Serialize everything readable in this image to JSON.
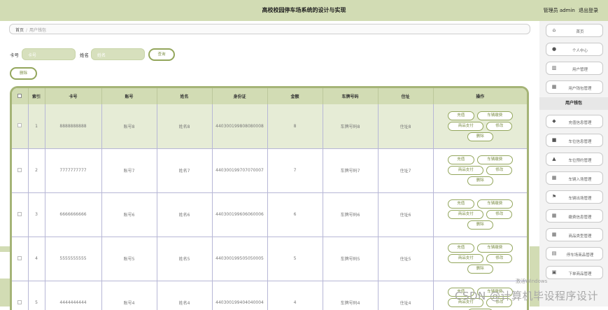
{
  "header": {
    "title": "高校校园停车场系统的设计与实现",
    "user_role": "管理员 admin",
    "logout": "退出登录"
  },
  "breadcrumb": {
    "home": "首页",
    "current": "用户钱包"
  },
  "search": {
    "card_label": "卡号",
    "card_placeholder": "卡号",
    "name_label": "姓名",
    "name_placeholder": "姓名",
    "query_button": "查询"
  },
  "delete_button": "删除",
  "table": {
    "headers": [
      "",
      "索引",
      "卡号",
      "账号",
      "姓名",
      "身份证",
      "金额",
      "车牌号码",
      "住址",
      "操作"
    ],
    "rows": [
      {
        "index": "1",
        "card": "8888888888",
        "account": "账号8",
        "name": "姓名8",
        "id_card": "440300199808080008",
        "amount": "8",
        "plate": "车牌号码8",
        "address": "住址8"
      },
      {
        "index": "2",
        "card": "7777777777",
        "account": "账号7",
        "name": "姓名7",
        "id_card": "440300199707070007",
        "amount": "7",
        "plate": "车牌号码7",
        "address": "住址7"
      },
      {
        "index": "3",
        "card": "6666666666",
        "account": "账号6",
        "name": "姓名6",
        "id_card": "440300199606060006",
        "amount": "6",
        "plate": "车牌号码6",
        "address": "住址6"
      },
      {
        "index": "4",
        "card": "5555555555",
        "account": "账号5",
        "name": "姓名5",
        "id_card": "440300199505050005",
        "amount": "5",
        "plate": "车牌号码5",
        "address": "住址5"
      },
      {
        "index": "5",
        "card": "4444444444",
        "account": "账号4",
        "name": "姓名4",
        "id_card": "440300199404040004",
        "amount": "4",
        "plate": "车牌号码4",
        "address": "住址4"
      }
    ],
    "ops": {
      "recharge": "充值",
      "car_fee": "车辆缴费",
      "goods_pay": "商品支付",
      "edit": "修改",
      "delete": "删除"
    }
  },
  "sidebar": {
    "items": [
      {
        "label": "首页",
        "icon": "home-icon"
      },
      {
        "label": "个人中心",
        "icon": "user-icon"
      },
      {
        "label": "用户管理",
        "icon": "bar-chart-icon"
      },
      {
        "label": "用户钱包管理",
        "icon": "grid-icon"
      },
      {
        "label": "充值信息管理",
        "icon": "pin-icon"
      },
      {
        "label": "车位信息管理",
        "icon": "square-icon"
      },
      {
        "label": "车位预约管理",
        "icon": "building-icon"
      },
      {
        "label": "车辆入场管理",
        "icon": "grid-icon"
      },
      {
        "label": "车辆出场管理",
        "icon": "flag-icon"
      },
      {
        "label": "缴费信息管理",
        "icon": "grid-icon"
      },
      {
        "label": "商品类型管理",
        "icon": "grid-icon"
      },
      {
        "label": "停车场商品管理",
        "icon": "table-icon"
      },
      {
        "label": "下单商品管理",
        "icon": "doc-icon"
      }
    ],
    "active_label": "用户钱包"
  },
  "watermark": {
    "windows": "激活Windows",
    "csdn": "CSDN @计算机毕设程序设计"
  }
}
